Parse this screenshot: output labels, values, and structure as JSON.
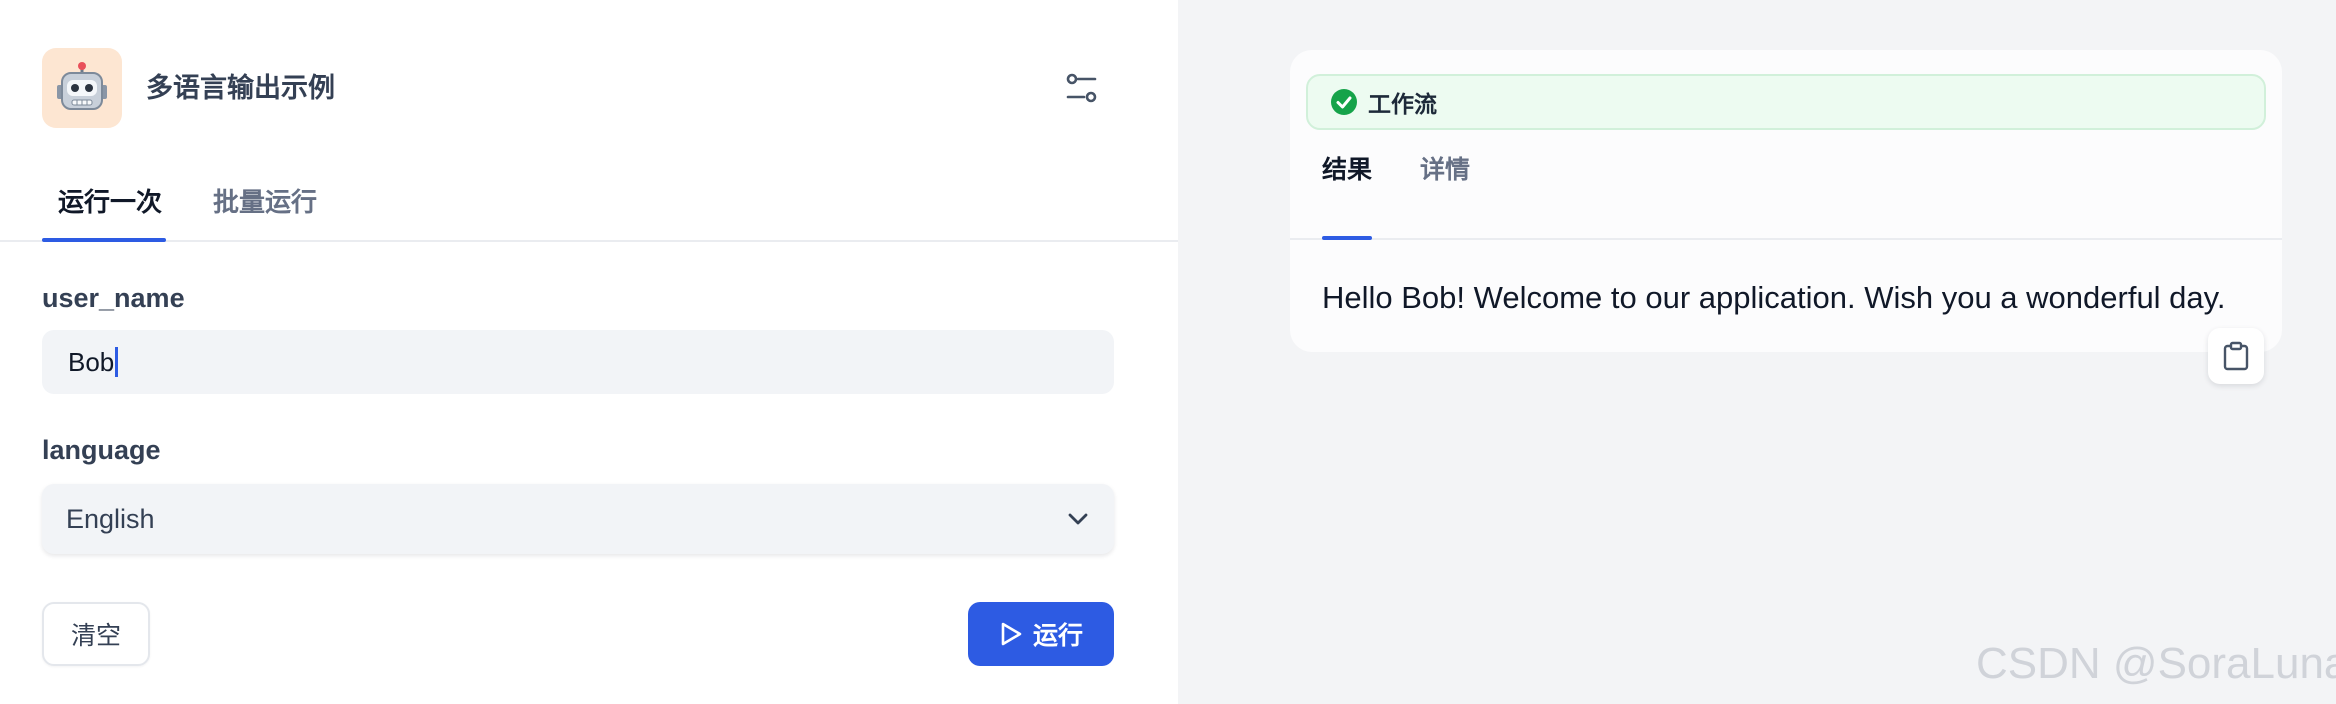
{
  "app": {
    "title": "多语言输出示例",
    "icon": "robot-emoji"
  },
  "tabs": [
    {
      "label": "运行一次",
      "active": true
    },
    {
      "label": "批量运行",
      "active": false
    }
  ],
  "form": {
    "user_name": {
      "label": "user_name",
      "value": "Bob"
    },
    "language": {
      "label": "language",
      "value": "English"
    }
  },
  "buttons": {
    "clear": "清空",
    "run": "运行"
  },
  "result": {
    "workflow_label": "工作流",
    "status": "success",
    "tabs": [
      {
        "label": "结果",
        "active": true
      },
      {
        "label": "详情",
        "active": false
      }
    ],
    "text": "Hello Bob! Welcome to our application. Wish you a wonderful day."
  },
  "watermark": "CSDN @SoraLuna",
  "colors": {
    "accent": "#2d5be3",
    "success": "#16a34a",
    "right_bg": "#f3f4f6"
  }
}
